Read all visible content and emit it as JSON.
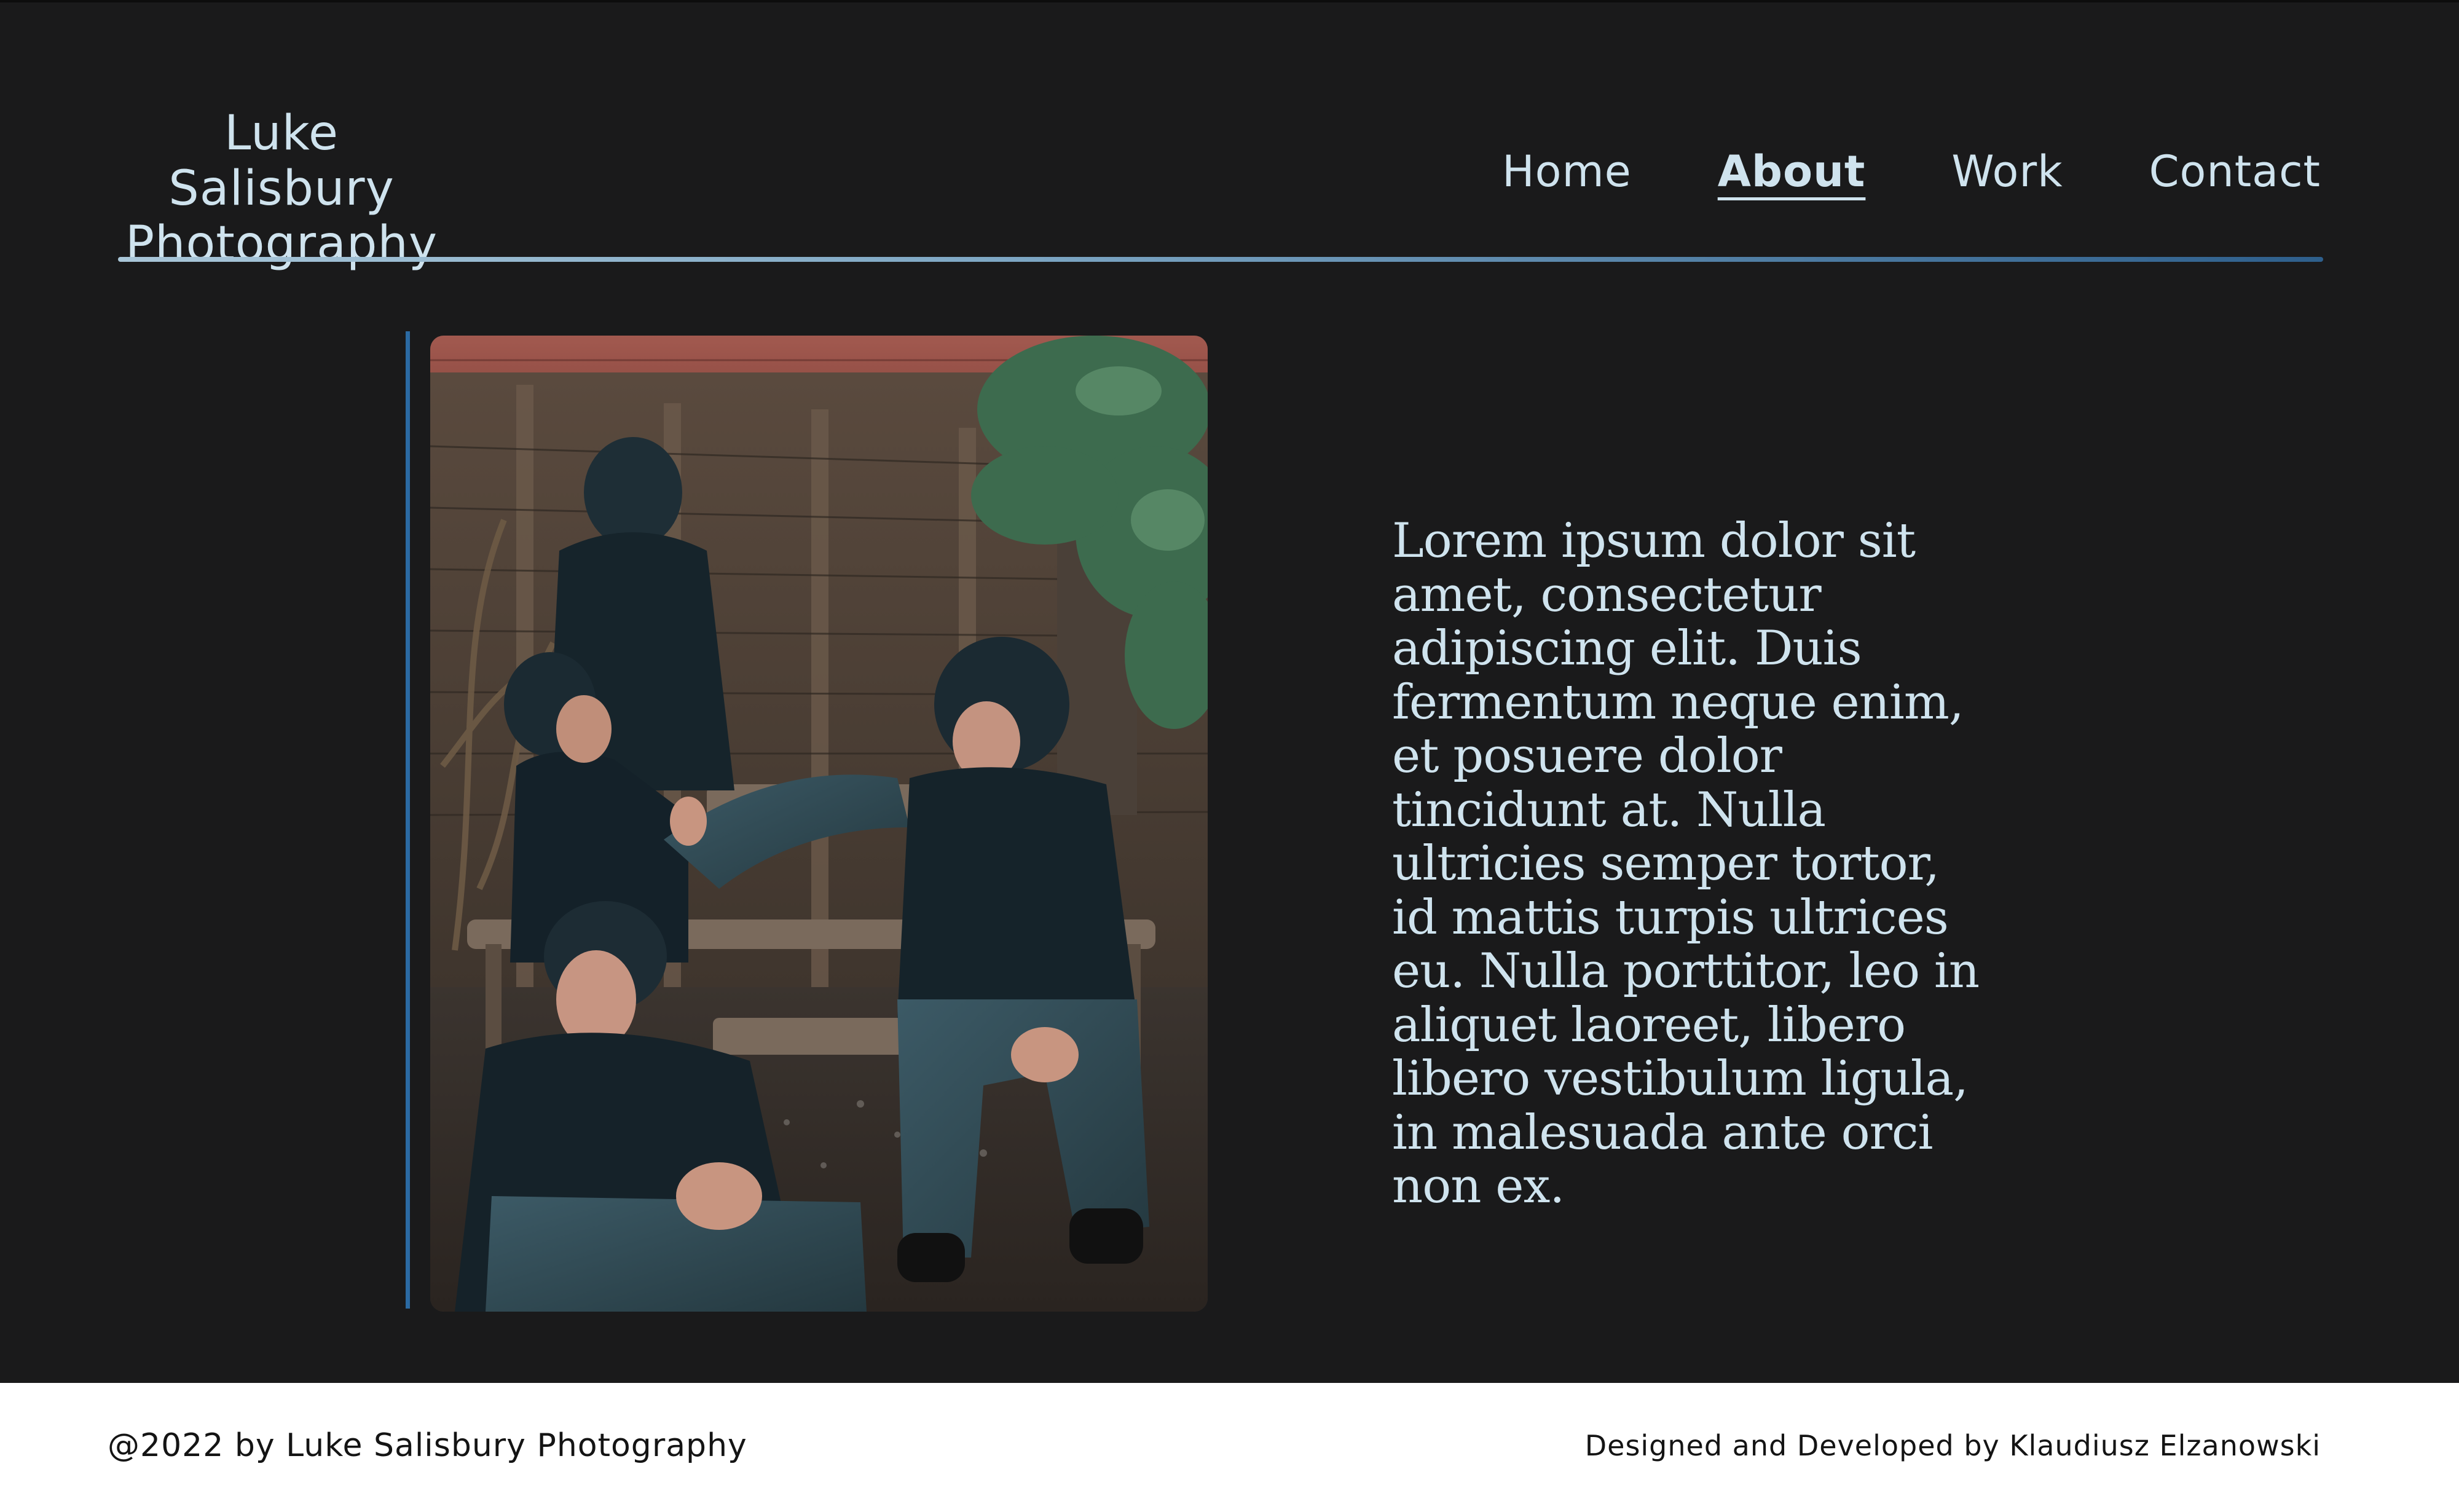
{
  "brand": {
    "line1": "Luke Salisbury",
    "line2": "Photography"
  },
  "nav": {
    "items": [
      {
        "label": "Home",
        "active": false
      },
      {
        "label": "About",
        "active": true
      },
      {
        "label": "Work",
        "active": false
      },
      {
        "label": "Contact",
        "active": false
      }
    ]
  },
  "about": {
    "photo_alt": "Composite photo of the same person in a black hoodie and cap appearing four times in a garden, sitting on and around a wooden bench",
    "bio": "Lorem ipsum dolor sit amet, consectetur adipiscing elit. Duis fermentum neque enim, et posuere dolor tincidunt at. Nulla ultricies semper tortor, id mattis turpis ultrices eu. Nulla porttitor, leo in aliquet laoreet, libero libero vestibulum ligula, in malesuada ante orci non ex."
  },
  "footer": {
    "copyright": "@2022 by Luke Salisbury Photography",
    "credit": "Designed and Developed by Klaudiusz Elzanowski"
  },
  "colors": {
    "background": "#1a1a1b",
    "text_light": "#cfe3ee",
    "accent_blue": "#2b6aa3",
    "footer_bg": "#ffffff",
    "footer_text": "#141414"
  }
}
